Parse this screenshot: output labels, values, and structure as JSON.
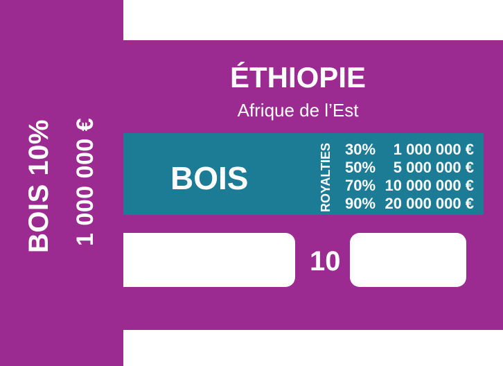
{
  "card": {
    "country": "ÉTHIOPIE",
    "region": "Afrique de l’Est",
    "resource": "BOIS",
    "side_text_primary": "BOIS  10%",
    "side_text_secondary": "1 000 000 €",
    "royalties_label": "ROYALTIES",
    "royalties": [
      {
        "pct": "30%",
        "amount": "1 000 000 €"
      },
      {
        "pct": "50%",
        "amount": "5 000 000 €"
      },
      {
        "pct": "70%",
        "amount": "10 000 000 €"
      },
      {
        "pct": "90%",
        "amount": "20 000 000 €"
      }
    ],
    "number": "10",
    "colors": {
      "card": "#9b2b91",
      "band": "#1c7c96",
      "text": "#ffffff"
    }
  }
}
